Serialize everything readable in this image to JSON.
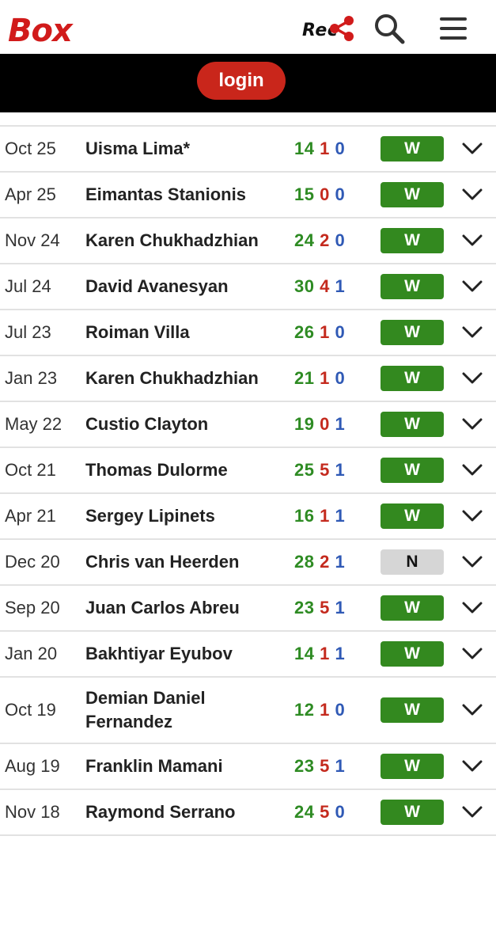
{
  "header": {
    "logo_part1": "Box",
    "logo_part2": "Rec",
    "icons": [
      "share-icon",
      "search-icon",
      "menu-icon"
    ],
    "colors": {
      "brand_red": "#d11b1b",
      "black": "#000000"
    }
  },
  "login": {
    "label": "login"
  },
  "colors": {
    "win": "#2e8b23",
    "loss": "#c42a1e",
    "draw": "#2f59b5",
    "result_win_bg": "#33891f",
    "result_nc_bg": "#d6d6d6"
  },
  "fights": [
    {
      "date": "Oct 25",
      "opponent": "Uisma Lima*",
      "w": "14",
      "l": "1",
      "d": "0",
      "result": "W"
    },
    {
      "date": "Apr 25",
      "opponent": "Eimantas Stanionis",
      "w": "15",
      "l": "0",
      "d": "0",
      "result": "W"
    },
    {
      "date": "Nov 24",
      "opponent": "Karen Chukhadzhian",
      "w": "24",
      "l": "2",
      "d": "0",
      "result": "W"
    },
    {
      "date": "Jul 24",
      "opponent": "David Avanesyan",
      "w": "30",
      "l": "4",
      "d": "1",
      "result": "W"
    },
    {
      "date": "Jul 23",
      "opponent": "Roiman Villa",
      "w": "26",
      "l": "1",
      "d": "0",
      "result": "W"
    },
    {
      "date": "Jan 23",
      "opponent": "Karen Chukhadzhian",
      "w": "21",
      "l": "1",
      "d": "0",
      "result": "W"
    },
    {
      "date": "May 22",
      "opponent": "Custio Clayton",
      "w": "19",
      "l": "0",
      "d": "1",
      "result": "W"
    },
    {
      "date": "Oct 21",
      "opponent": "Thomas Dulorme",
      "w": "25",
      "l": "5",
      "d": "1",
      "result": "W"
    },
    {
      "date": "Apr 21",
      "opponent": "Sergey Lipinets",
      "w": "16",
      "l": "1",
      "d": "1",
      "result": "W"
    },
    {
      "date": "Dec 20",
      "opponent": "Chris van Heerden",
      "w": "28",
      "l": "2",
      "d": "1",
      "result": "N"
    },
    {
      "date": "Sep 20",
      "opponent": "Juan Carlos Abreu",
      "w": "23",
      "l": "5",
      "d": "1",
      "result": "W"
    },
    {
      "date": "Jan 20",
      "opponent": "Bakhtiyar Eyubov",
      "w": "14",
      "l": "1",
      "d": "1",
      "result": "W"
    },
    {
      "date": "Oct 19",
      "opponent": "Demian Daniel Fernandez",
      "w": "12",
      "l": "1",
      "d": "0",
      "result": "W"
    },
    {
      "date": "Aug 19",
      "opponent": "Franklin Mamani",
      "w": "23",
      "l": "5",
      "d": "1",
      "result": "W"
    },
    {
      "date": "Nov 18",
      "opponent": "Raymond Serrano",
      "w": "24",
      "l": "5",
      "d": "0",
      "result": "W"
    }
  ]
}
